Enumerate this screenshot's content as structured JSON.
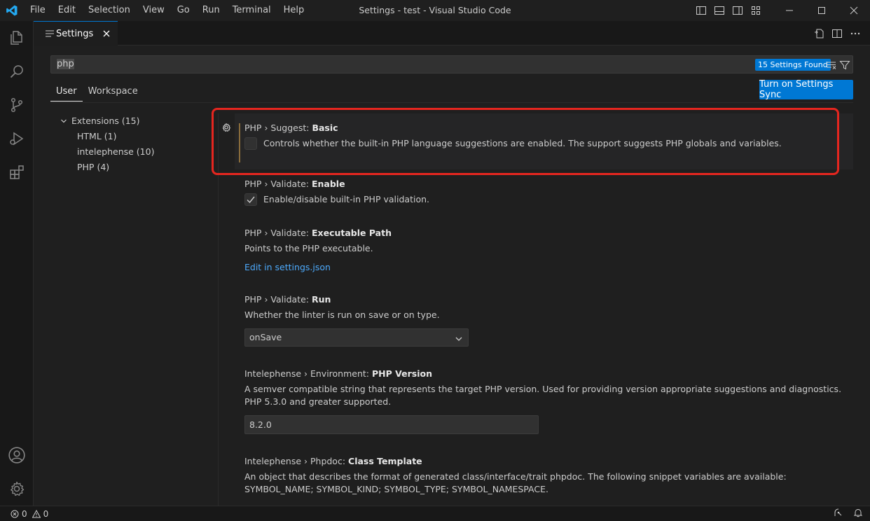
{
  "window": {
    "title": "Settings - test - Visual Studio Code",
    "menu": [
      "File",
      "Edit",
      "Selection",
      "View",
      "Go",
      "Run",
      "Terminal",
      "Help"
    ]
  },
  "tab": {
    "label": "Settings"
  },
  "search": {
    "value": "php",
    "results_badge": "15 Settings Found"
  },
  "scope_tabs": [
    "User",
    "Workspace"
  ],
  "sync_button": "Turn on Settings Sync",
  "toc": {
    "group": "Extensions (15)",
    "children": [
      "HTML (1)",
      "intelephense (10)",
      "PHP (4)"
    ]
  },
  "settings": [
    {
      "category": "PHP › Suggest: ",
      "key": "Basic",
      "description": "Controls whether the built-in PHP language suggestions are enabled. The support suggests PHP globals and variables.",
      "checked": false
    },
    {
      "category": "PHP › Validate: ",
      "key": "Enable",
      "description": "Enable/disable built-in PHP validation.",
      "checked": true
    },
    {
      "category": "PHP › Validate: ",
      "key": "Executable Path",
      "description": "Points to the PHP executable.",
      "link": "Edit in settings.json"
    },
    {
      "category": "PHP › Validate: ",
      "key": "Run",
      "description": "Whether the linter is run on save or on type.",
      "select_value": "onSave"
    },
    {
      "category": "Intelephense › Environment: ",
      "key": "PHP Version",
      "description": "A semver compatible string that represents the target PHP version. Used for providing version appropriate suggestions and diagnostics. PHP 5.3.0 and greater supported.",
      "input_value": "8.2.0"
    },
    {
      "category": "Intelephense › Phpdoc: ",
      "key": "Class Template",
      "description": "An object that describes the format of generated class/interface/trait phpdoc. The following snippet variables are available: SYMBOL_NAME; SYMBOL_KIND; SYMBOL_TYPE; SYMBOL_NAMESPACE."
    }
  ],
  "status": {
    "errors": "0",
    "warnings": "0"
  },
  "colors": {
    "accent": "#0078d4",
    "annotation": "#e5261f",
    "link": "#4daafc"
  }
}
